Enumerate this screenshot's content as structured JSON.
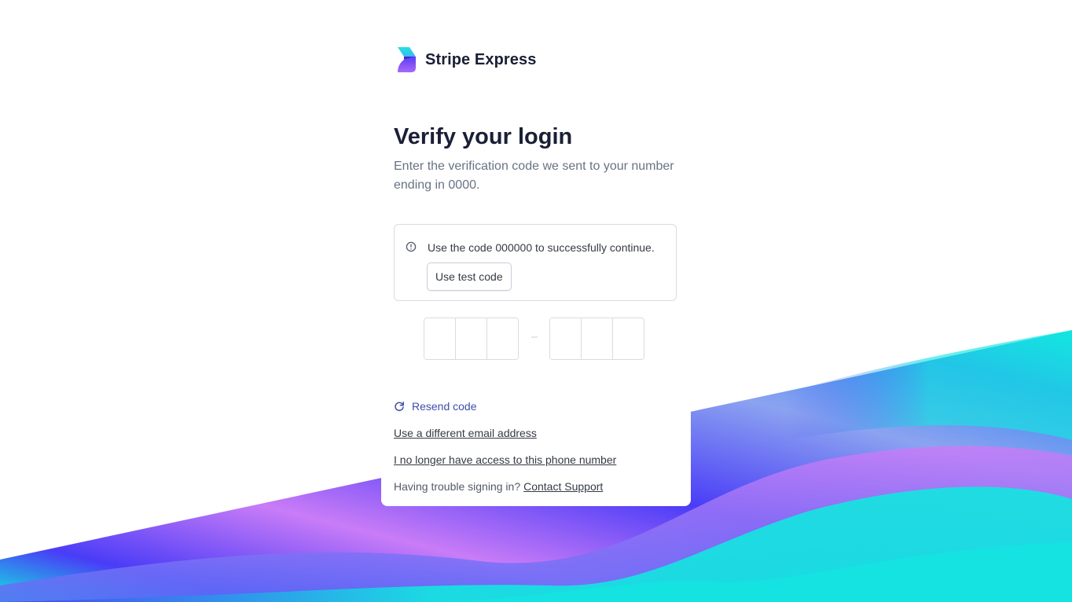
{
  "brand": {
    "name": "Stripe Express",
    "logo_icon": "stripe-express-logo-icon",
    "colors": {
      "logo_top": "#1ee3dc",
      "logo_bottom": "#7a3cf5",
      "link_blue": "#3d4eac",
      "heading": "#1a1f36"
    }
  },
  "page": {
    "title": "Verify your login",
    "subtitle": "Enter the verification code we sent to your number ending in 0000."
  },
  "notice": {
    "icon": "info-circle-icon",
    "text": "Use the code 000000 to successfully continue.",
    "button_label": "Use test code"
  },
  "code_input": {
    "digits": [
      "",
      "",
      "",
      "",
      "",
      ""
    ],
    "separator": "-"
  },
  "actions": {
    "resend_icon": "refresh-icon",
    "resend_label": "Resend code",
    "different_email": "Use a different email address",
    "no_phone_access": "I no longer have access to this phone number",
    "trouble_text": "Having trouble signing in?",
    "support_link": "Contact Support"
  },
  "background": {
    "colors": [
      "#13e6e0",
      "#4a3cf7",
      "#c97cf7",
      "#8b6af7"
    ]
  }
}
